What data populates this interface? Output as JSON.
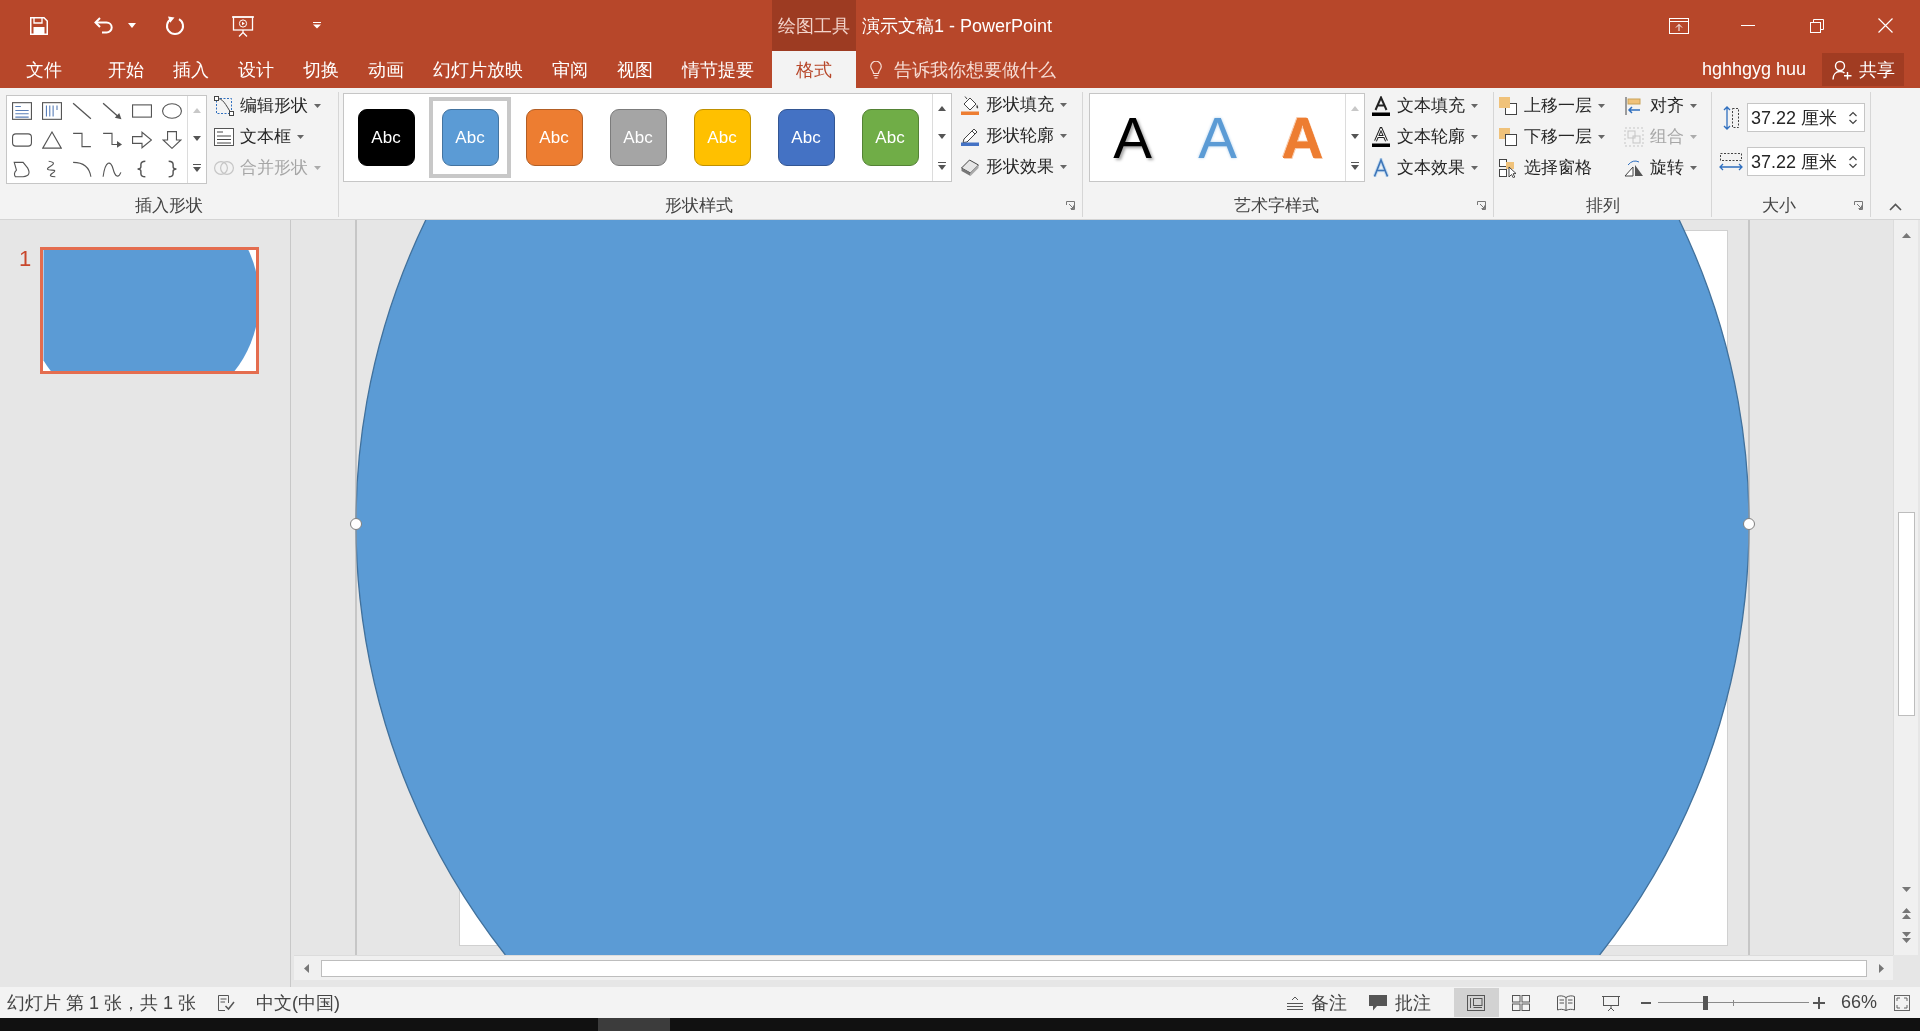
{
  "title_bar": {
    "context_group": "绘图工具",
    "title": "演示文稿1 - PowerPoint"
  },
  "ribbon_tabs": [
    {
      "label": "文件",
      "selected": false
    },
    {
      "label": "开始",
      "selected": false
    },
    {
      "label": "插入",
      "selected": false
    },
    {
      "label": "设计",
      "selected": false
    },
    {
      "label": "切换",
      "selected": false
    },
    {
      "label": "动画",
      "selected": false
    },
    {
      "label": "幻灯片放映",
      "selected": false
    },
    {
      "label": "审阅",
      "selected": false
    },
    {
      "label": "视图",
      "selected": false
    },
    {
      "label": "情节提要",
      "selected": false
    }
  ],
  "contextual_tabs": [
    {
      "label": "格式",
      "selected": true
    }
  ],
  "tell_me": {
    "text": "告诉我你想要做什么"
  },
  "account": {
    "user_name": "hghhgyg huu",
    "share": "共享"
  },
  "ribbon": {
    "insert_shapes": {
      "label": "插入形状",
      "dialog_launcher": false,
      "scroll_up_disabled": true,
      "commands": [
        {
          "label": "编辑形状",
          "dropdown": true,
          "disabled": false
        },
        {
          "label": "文本框",
          "dropdown": true,
          "disabled": false
        },
        {
          "label": "合并形状",
          "dropdown": true,
          "disabled": true
        }
      ]
    },
    "shape_styles": {
      "label": "形状样式",
      "dialog_launcher": true,
      "scroll_up_disabled": false,
      "styles": [
        {
          "text": "Abc",
          "color": "#000000",
          "selected": false
        },
        {
          "text": "Abc",
          "color": "#5b9bd5",
          "selected": true
        },
        {
          "text": "Abc",
          "color": "#ed7d31",
          "selected": false
        },
        {
          "text": "Abc",
          "color": "#a5a5a5",
          "selected": false
        },
        {
          "text": "Abc",
          "color": "#ffc000",
          "selected": false
        },
        {
          "text": "Abc",
          "color": "#4472c4",
          "selected": false
        },
        {
          "text": "Abc",
          "color": "#70ad47",
          "selected": false
        }
      ],
      "commands": [
        {
          "label": "形状填充",
          "dropdown": true,
          "disabled": false
        },
        {
          "label": "形状轮廓",
          "dropdown": true,
          "disabled": false
        },
        {
          "label": "形状效果",
          "dropdown": true,
          "disabled": false
        }
      ]
    },
    "wordart_styles": {
      "label": "艺术字样式",
      "dialog_launcher": true,
      "scroll_up_disabled": true,
      "styles": [
        {
          "text": "A",
          "kind": "shadow",
          "color": "#000000"
        },
        {
          "text": "A",
          "kind": "glow",
          "color": "#5b9bd5"
        },
        {
          "text": "A",
          "kind": "outline",
          "color": "#ed7d31"
        }
      ],
      "commands": [
        {
          "label": "文本填充",
          "dropdown": true,
          "disabled": false
        },
        {
          "label": "文本轮廓",
          "dropdown": true,
          "disabled": false
        },
        {
          "label": "文本效果",
          "dropdown": true,
          "disabled": false
        }
      ]
    },
    "arrange": {
      "label": "排列",
      "dialog_launcher": false,
      "commands": [
        {
          "label": "上移一层",
          "dropdown": true,
          "disabled": false
        },
        {
          "label": "下移一层",
          "dropdown": true,
          "disabled": false
        },
        {
          "label": "选择窗格",
          "dropdown": false,
          "disabled": false
        },
        {
          "label": "对齐",
          "dropdown": true,
          "disabled": false
        },
        {
          "label": "组合",
          "dropdown": true,
          "disabled": true
        },
        {
          "label": "旋转",
          "dropdown": true,
          "disabled": false
        }
      ]
    },
    "size": {
      "label": "大小",
      "dialog_launcher": true,
      "height": "37.22 厘米",
      "width": "37.22 厘米"
    }
  },
  "slides_pane": {
    "slides": [
      {
        "number": "1",
        "selected": true
      }
    ]
  },
  "slide_canvas": {
    "shape_selected": true
  },
  "status_bar": {
    "slide_info": "幻灯片 第 1 张，共 1 张",
    "language": "中文(中国)",
    "notes": "备注",
    "comments": "批注",
    "views": [
      {
        "kind": "normal",
        "selected": true
      },
      {
        "kind": "slide_sorter",
        "selected": false
      },
      {
        "kind": "reading",
        "selected": false
      },
      {
        "kind": "slideshow",
        "selected": false
      }
    ],
    "zoom": {
      "level": 0.31,
      "reading": "66%"
    }
  }
}
